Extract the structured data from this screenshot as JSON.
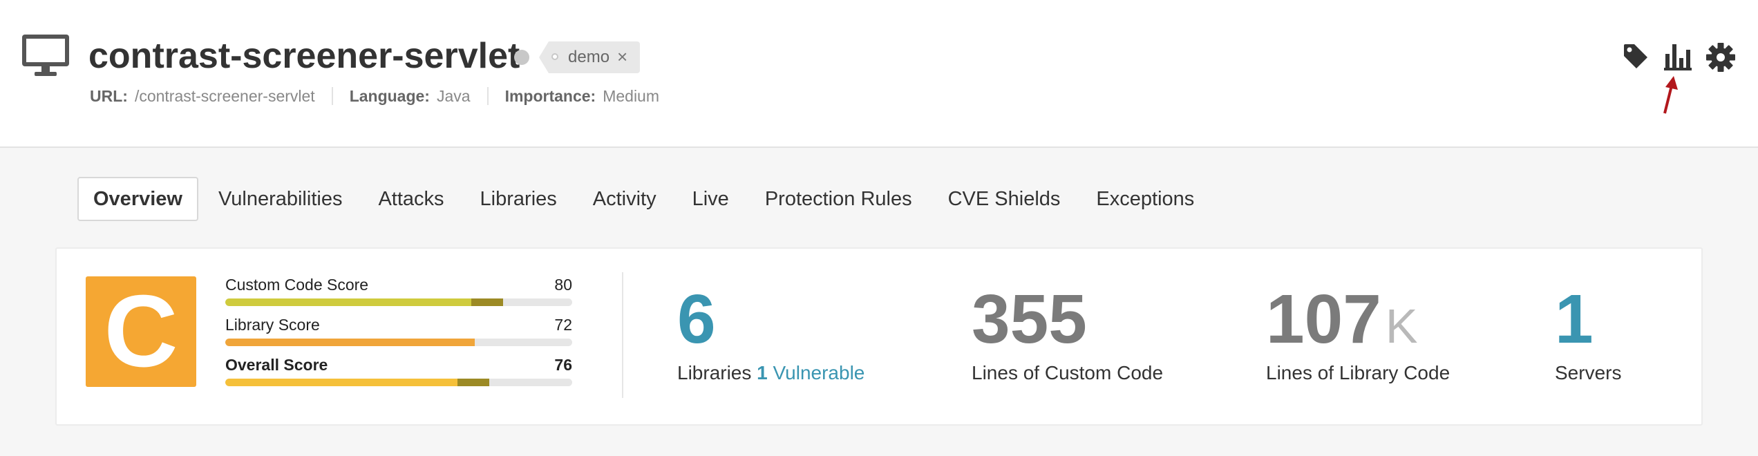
{
  "app": {
    "title": "contrast-screener-servlet",
    "tag": "demo",
    "tag_close": "×",
    "meta": {
      "url_label": "URL:",
      "url_value": "/contrast-screener-servlet",
      "language_label": "Language:",
      "language_value": "Java",
      "importance_label": "Importance:",
      "importance_value": "Medium"
    }
  },
  "header_icons": [
    "tag-icon",
    "bar-chart-icon",
    "gear-icon"
  ],
  "annotation_color": "#b2171c",
  "tabs": [
    {
      "label": "Overview",
      "active": true
    },
    {
      "label": "Vulnerabilities"
    },
    {
      "label": "Attacks"
    },
    {
      "label": "Libraries"
    },
    {
      "label": "Activity"
    },
    {
      "label": "Live"
    },
    {
      "label": "Protection Rules"
    },
    {
      "label": "CVE Shields"
    },
    {
      "label": "Exceptions"
    }
  ],
  "summary": {
    "grade": "C",
    "grade_color": "#f5a733",
    "scores": [
      {
        "label": "Custom Code Score",
        "value": "80",
        "fraction": 0.8,
        "color": "#cfcb3d"
      },
      {
        "label": "Library Score",
        "value": "72",
        "fraction": 0.72,
        "color": "#f0a53a"
      },
      {
        "label": "Overall Score",
        "value": "76",
        "fraction": 0.76,
        "color": "#f5c03a"
      }
    ],
    "stats": {
      "libraries": {
        "value": "6",
        "label": "Libraries",
        "vulnerable_count": "1",
        "vulnerable_label": "Vulnerable"
      },
      "custom_code": {
        "value": "355",
        "label": "Lines of Custom Code"
      },
      "library_code": {
        "value": "107",
        "unit": "K",
        "label": "Lines of Library Code"
      },
      "servers": {
        "value": "1",
        "label": "Servers"
      }
    }
  }
}
